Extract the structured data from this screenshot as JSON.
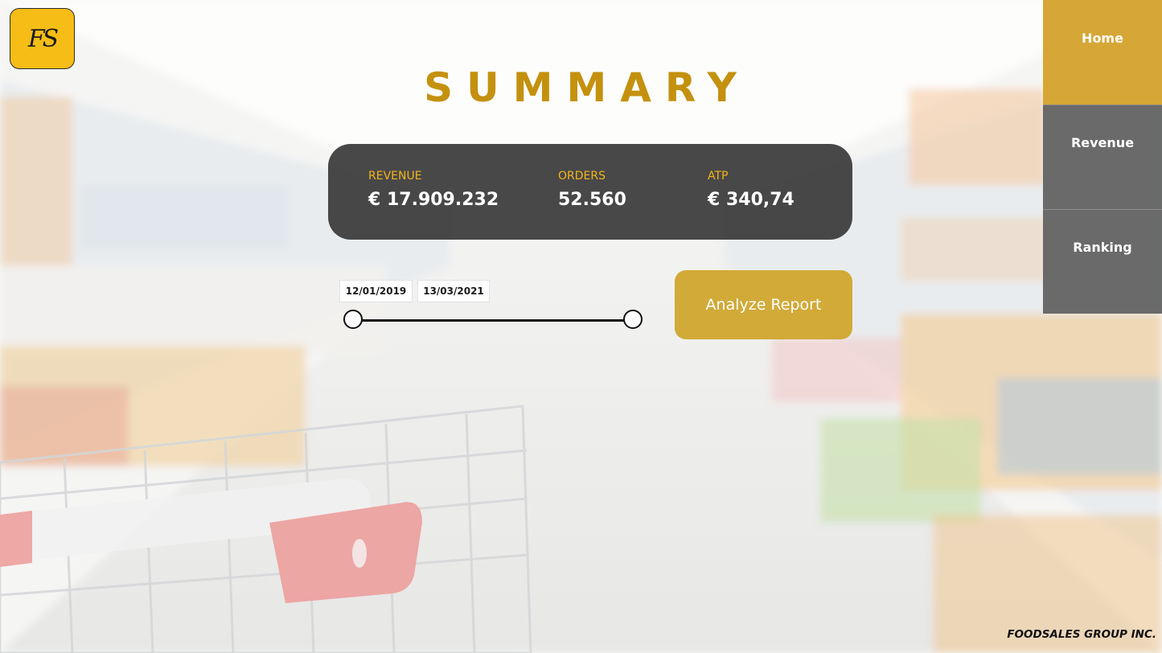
{
  "logo": {
    "text": "FS"
  },
  "title": "SUMMARY",
  "kpis": [
    {
      "label": "REVENUE",
      "value": "€ 17.909.232"
    },
    {
      "label": "ORDERS",
      "value": "52.560"
    },
    {
      "label": "ATP",
      "value": "€ 340,74"
    }
  ],
  "date_range": {
    "start": "12/01/2019",
    "end": "13/03/2021"
  },
  "analyze_button": {
    "label": "Analyze Report"
  },
  "nav": {
    "items": [
      {
        "label": "Home",
        "active": true
      },
      {
        "label": "Revenue",
        "active": false
      },
      {
        "label": "Ranking",
        "active": false
      }
    ]
  },
  "footer": "FOODSALES GROUP INC.",
  "colors": {
    "accent": "#c4910f",
    "logo_bg": "#f6bd16",
    "kpi_label": "#f4b41c",
    "kpi_card": "#3a3a3a",
    "nav_active": "#d6a737",
    "nav_inactive": "#626262"
  }
}
